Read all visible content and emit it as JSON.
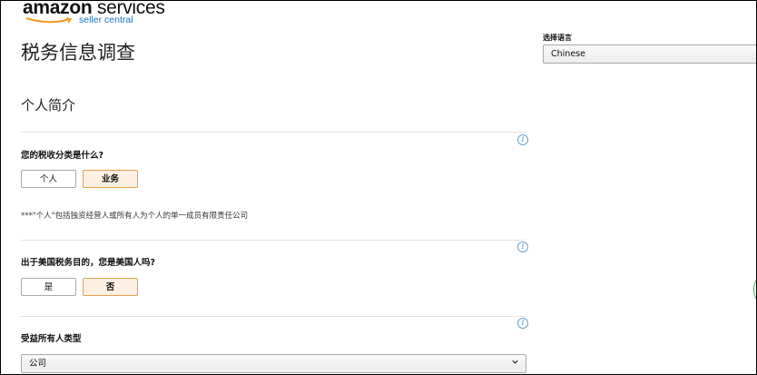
{
  "header": {
    "logo_main": "amazon",
    "logo_services": "services",
    "logo_tm": "·",
    "logo_sub": "seller central"
  },
  "page": {
    "title": "税务信息调查",
    "section_title": "个人简介"
  },
  "language": {
    "label": "选择语言",
    "value": "Chinese"
  },
  "questions": {
    "tax_class": {
      "label": "您的税收分类是什么?",
      "options": [
        "个人",
        "业务"
      ],
      "selected": "业务",
      "note": "***\"个人\"包括独资经营人或所有人为个人的单一成员有限责任公司"
    },
    "us_person": {
      "label": "出于美国税务目的，您是美国人吗?",
      "options": [
        "是",
        "否"
      ],
      "selected": "否"
    },
    "beneficial_owner": {
      "label": "受益所有人类型",
      "value": "公司"
    }
  },
  "icons": {
    "info": "i"
  },
  "colors": {
    "selected_border": "#e4a04a",
    "selected_bg": "#fdf0e2",
    "link_blue": "#1a73b8"
  }
}
